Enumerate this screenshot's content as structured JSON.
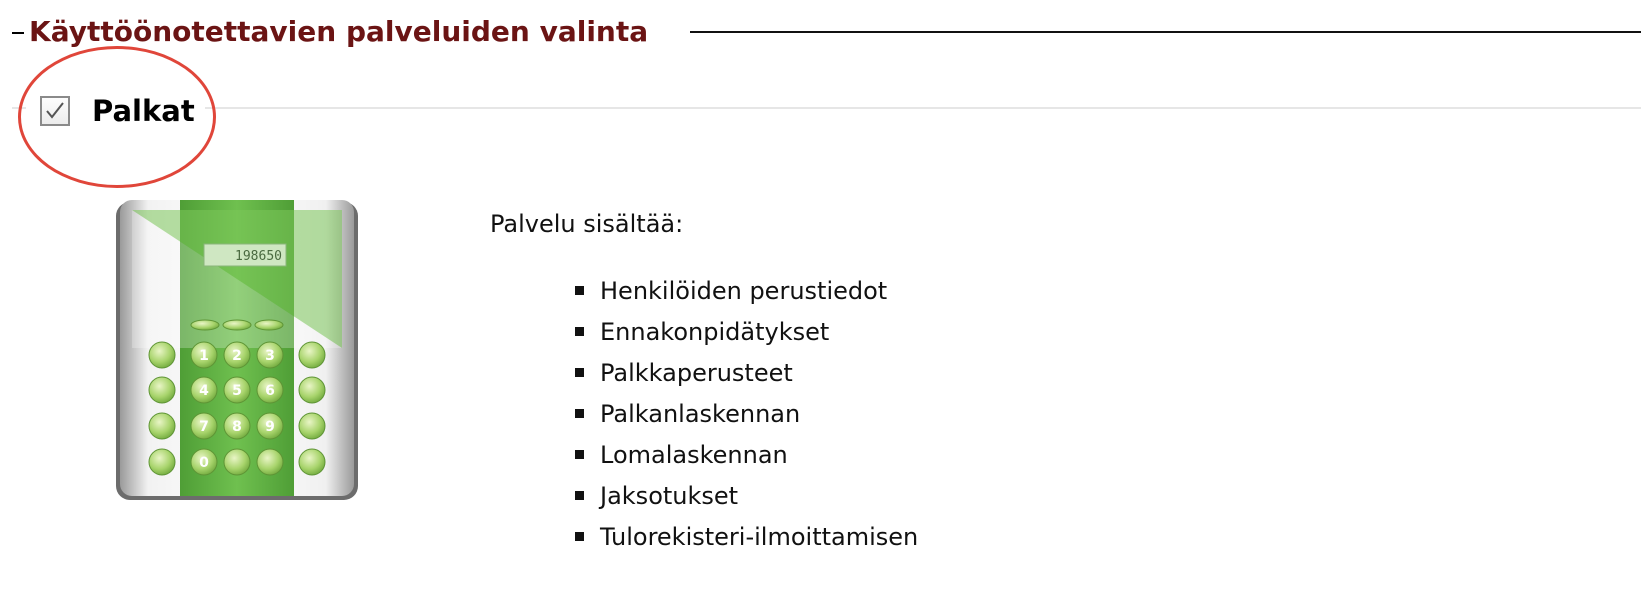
{
  "section": {
    "legend": "Käyttöönotettavien palveluiden valinta"
  },
  "service": {
    "title": "Palkat",
    "checked": true,
    "image_icon": "calculator-icon",
    "calculator_display": "198650",
    "contains_heading": "Palvelu sisältää:",
    "features": [
      "Henkilöiden perustiedot",
      "Ennakonpidätykset",
      "Palkkaperusteet",
      "Palkanlaskennan",
      "Lomalaskennan",
      "Jaksotukset",
      "Tulorekisteri-ilmoittamisen"
    ]
  },
  "colors": {
    "legend_text": "#6b1414",
    "highlight": "#e0463a",
    "calculator_green": "#5fb144"
  }
}
